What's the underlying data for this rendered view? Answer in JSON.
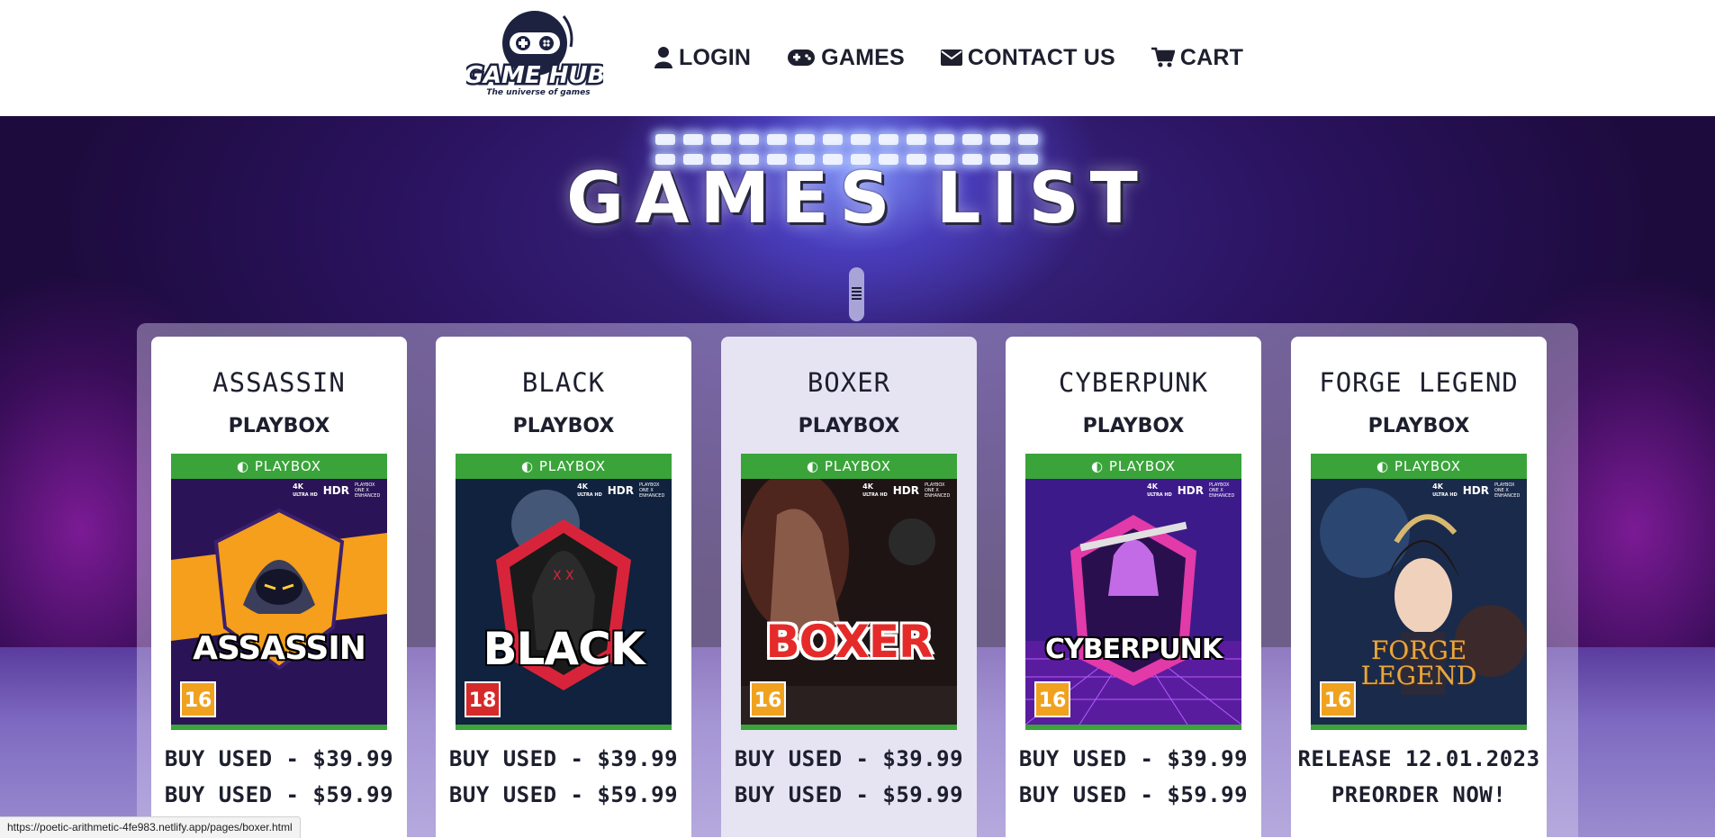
{
  "header": {
    "logo_name": "GAME HUB",
    "logo_tagline": "The universe of games",
    "nav": [
      {
        "label": "LOGIN",
        "icon": "user-icon"
      },
      {
        "label": "GAMES",
        "icon": "gamepad-icon"
      },
      {
        "label": "CONTACT US",
        "icon": "envelope-icon"
      },
      {
        "label": "CART",
        "icon": "cart-icon"
      }
    ]
  },
  "hero": {
    "title": "GAMES LIST"
  },
  "cover_common": {
    "platform_bar": "PLAYBOX",
    "badge_4k": "4K",
    "badge_4k_sub": "ULTRA HD",
    "badge_hdr": "HDR",
    "badge_enhanced": "PLAYBOX ONE X ENHANCED"
  },
  "games": [
    {
      "title": "ASSASSIN",
      "platform": "PLAYBOX",
      "cover_name": "ASSASSIN",
      "age": "16",
      "line1": "BUY USED - $39.99",
      "line2": "BUY USED - $59.99",
      "accent": "#f59f1c"
    },
    {
      "title": "BLACK",
      "platform": "PLAYBOX",
      "cover_name": "BLACK",
      "age": "18",
      "line1": "BUY USED - $39.99",
      "line2": "BUY USED - $59.99",
      "accent": "#d8243a"
    },
    {
      "title": "BOXER",
      "platform": "PLAYBOX",
      "cover_name": "BOXER",
      "age": "16",
      "line1": "BUY USED - $39.99",
      "line2": "BUY USED - $59.99",
      "accent": "#e52a2a"
    },
    {
      "title": "CYBERPUNK",
      "platform": "PLAYBOX",
      "cover_name": "CYBERPUNK",
      "age": "16",
      "line1": "BUY USED - $39.99",
      "line2": "BUY USED - $59.99",
      "accent": "#e23aa8"
    },
    {
      "title": "FORGE LEGEND",
      "platform": "PLAYBOX",
      "cover_name_1": "FORGE",
      "cover_name_2": "LEGEND",
      "age": "16",
      "line1": "RELEASE 12.01.2023",
      "line2": "PREORDER NOW!",
      "accent": "#e7a83f"
    }
  ],
  "status_url": "https://poetic-arithmetic-4fe983.netlify.app/pages/boxer.html",
  "colors": {
    "nav_text": "#1d1f2e",
    "cover_bar": "#3aa43a",
    "hero_bg": "#2b1360"
  }
}
